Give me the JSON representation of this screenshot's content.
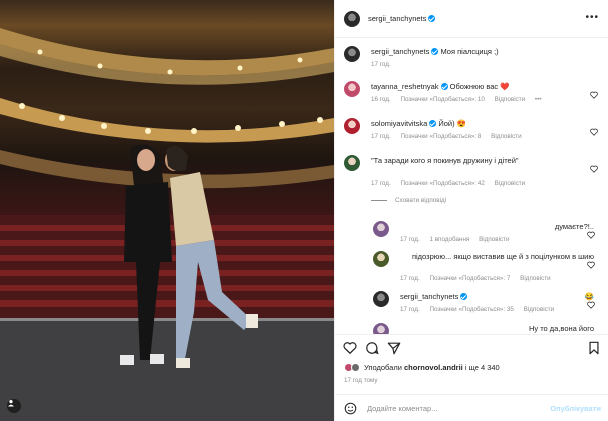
{
  "post": {
    "author": "sergii_tanchynets",
    "author_time": "17 год.",
    "caption_user": "sergii_tanchynets",
    "caption_text": "Моя піалсциця ;)",
    "caption_time": "17 год."
  },
  "comments": [
    {
      "user": "tayanna_reshetnyak",
      "text": "Обожнюю вас ❤️",
      "time": "16 год.",
      "likes": "Позначки «Подобається»: 10",
      "reply": "Відповісти",
      "more": "•••"
    },
    {
      "user": "solomiyavitvitska",
      "text": "Йой) 😍",
      "time": "17 год.",
      "likes": "Позначки «Подобається»: 8",
      "reply": "Відповісти"
    },
    {
      "user": "",
      "text": "\"Та заради кого я покинув дружину і дітей\"",
      "time": "17 год.",
      "likes": "Позначки «Подобається»: 42",
      "reply": "Відповісти"
    }
  ],
  "hide_replies": "Сховати відповіді",
  "replies": [
    {
      "user": "",
      "text": "думаєте?!..",
      "time": "17 год.",
      "likes": "1 вподобання",
      "reply": "Відповісти"
    },
    {
      "user": "",
      "text": "підозрюю... якщо виставив ще й з поцілунком в шию",
      "time": "17 год.",
      "likes": "Позначки «Подобається»: 7",
      "reply": "Відповісти"
    },
    {
      "user": "sergii_tanchynets",
      "text": "😂",
      "time": "17 год.",
      "likes": "Позначки «Подобається»: 35",
      "reply": "Відповісти"
    },
    {
      "user": "",
      "text": "Ну то да,вона його",
      "time": "",
      "likes": "",
      "reply": ""
    }
  ],
  "actions": {
    "liked_by_prefix": "Уподобали",
    "liked_by_user": "chornovol.andrii",
    "liked_by_suffix": "і ще 4 340",
    "time_ago": "17 год тому"
  },
  "composer": {
    "placeholder": "Додайте коментар...",
    "post_label": "Опублікувати"
  },
  "icons": {
    "like": "heart-icon",
    "comment": "comment-icon",
    "share": "share-icon",
    "save": "bookmark-icon",
    "emoji": "emoji-icon",
    "more": "more-icon",
    "user": "user-tag-icon"
  },
  "colors": {
    "verified": "#0095f6",
    "secondary_text": "#8e8e8e",
    "post_disabled": "#b2dffc"
  }
}
